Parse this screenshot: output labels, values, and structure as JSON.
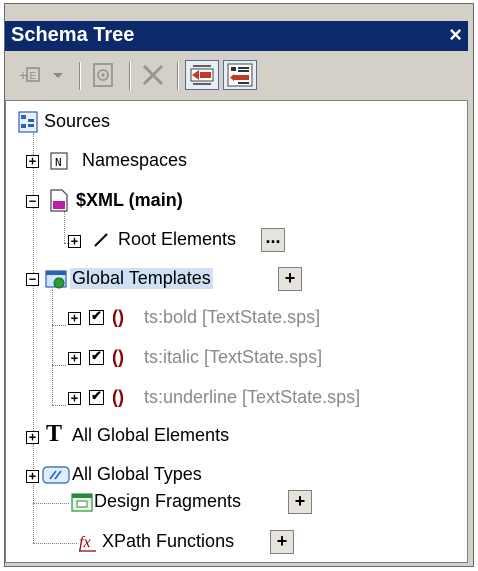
{
  "window": {
    "title": "Schema Tree",
    "close_glyph": "×"
  },
  "toolbar": {
    "buttons": [
      {
        "name": "add-element-button",
        "icon": "add-element-icon",
        "state": "disabled"
      },
      {
        "name": "add-dropdown-button",
        "icon": "chevron-down-icon",
        "state": "disabled"
      },
      {
        "name": "element-properties-button",
        "icon": "properties-icon",
        "state": "disabled"
      },
      {
        "name": "delete-button",
        "icon": "delete-icon",
        "state": "disabled"
      },
      {
        "name": "sort-button",
        "icon": "sort-icon",
        "state": "active"
      },
      {
        "name": "show-source-button",
        "icon": "source-icon",
        "state": "active"
      }
    ]
  },
  "tree": {
    "sources": "Sources",
    "namespaces": "Namespaces",
    "xml_main": "$XML (main)",
    "root_elements": "Root Elements",
    "root_elements_button": "...",
    "global_templates": "Global Templates",
    "global_templates_add": "+",
    "templates": [
      {
        "label": "ts:bold [TextState.sps]",
        "checked": true
      },
      {
        "label": "ts:italic [TextState.sps]",
        "checked": true
      },
      {
        "label": "ts:underline [TextState.sps]",
        "checked": true
      }
    ],
    "all_global_elements": "All Global Elements",
    "all_global_types": "All Global Types",
    "design_fragments": "Design Fragments",
    "design_fragments_add": "+",
    "xpath_functions": "XPath Functions",
    "xpath_functions_add": "+",
    "expand_glyph": "+",
    "collapse_glyph": "−",
    "namespace_glyph": "N",
    "elements_glyph": "T",
    "script_glyph": "()",
    "fx_glyph": "fx",
    "check_glyph": "✔"
  },
  "colors": {
    "titlebar_bg": "#0a2a6b",
    "selection_bg": "#cfe0f5",
    "grey_text": "#8a8a8a",
    "template_red": "#8b0000"
  }
}
